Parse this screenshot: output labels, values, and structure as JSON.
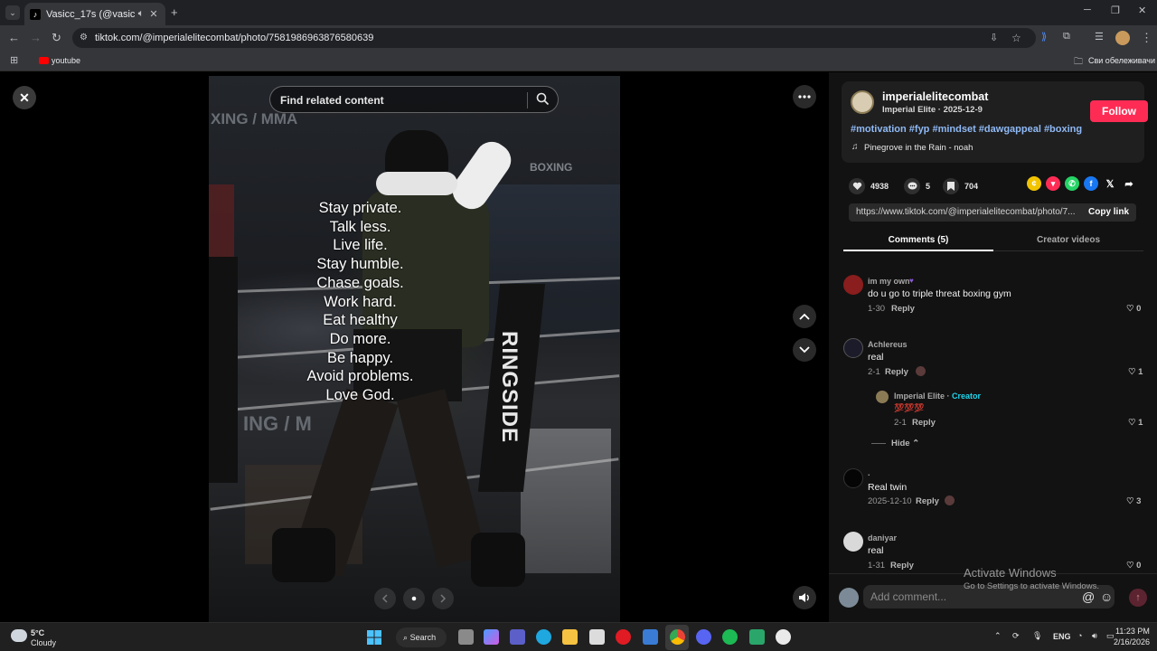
{
  "browser": {
    "tab_title": "Vasicc_17s (@vasicc_17.a) |",
    "url": "tiktok.com/@imperialelitecombat/photo/7581986963876580639",
    "bookmark_youtube": "youtube",
    "bookmarks_all": "Сви обележивачи"
  },
  "viewer": {
    "search_placeholder": "Find related content",
    "post_lines": [
      "Stay private.",
      "Talk less.",
      "Live life.",
      "Stay humble.",
      "Chase goals.",
      "Work hard.",
      "Eat healthy",
      "Do more.",
      "Be happy.",
      "Avoid problems.",
      "Love God."
    ],
    "background_signs": {
      "xing_mma": "XING / MMA",
      "ing_m": "ING / M",
      "boxing": "BOXING",
      "ringside": "RINGSIDE"
    }
  },
  "creator": {
    "username": "imperialelitecombat",
    "display_and_date": "Imperial Elite · 2025-12-9",
    "follow_label": "Follow",
    "hashtags": "#motivation #fyp #mindset #dawgappeal #boxing",
    "music": "Pinegrove in the Rain - noah"
  },
  "stats": {
    "likes": "4938",
    "comments": "5",
    "saves": "704"
  },
  "share_link": {
    "url": "https://www.tiktok.com/@imperialelitecombat/photo/7...",
    "copy_label": "Copy link"
  },
  "tabs": {
    "comments": "Comments (5)",
    "creator_videos": "Creator videos"
  },
  "comments": [
    {
      "name": "im my own",
      "text": "do u go to triple threat boxing gym",
      "date": "1-30",
      "reply": "Reply",
      "likes": "0"
    },
    {
      "name": "Achlereus",
      "text": "real",
      "date": "2-1",
      "reply": "Reply",
      "likes": "1"
    },
    {
      "name": "Imperial Elite",
      "creator_tag": "Creator",
      "text": "💯💯💯",
      "date": "2-1",
      "reply": "Reply",
      "likes": "1"
    },
    {
      "name": ".",
      "text": "Real twin",
      "date": "2025-12-10",
      "reply": "Reply",
      "likes": "3"
    },
    {
      "name": "daniyar",
      "text": "real",
      "date": "1-31",
      "reply": "Reply",
      "likes": "0"
    }
  ],
  "hide_label": "Hide",
  "comment_input_placeholder": "Add comment...",
  "activate": {
    "title": "Activate Windows",
    "sub": "Go to Settings to activate Windows."
  },
  "taskbar": {
    "weather_temp": "5°C",
    "weather_desc": "Cloudy",
    "search_label": "Search",
    "lang": "ENG",
    "time": "11:23 PM",
    "date": "2/16/2026"
  },
  "colors": {
    "accent": "#fe2c55",
    "hashtag": "#8fb9f5",
    "creator": "#20d5ec"
  }
}
